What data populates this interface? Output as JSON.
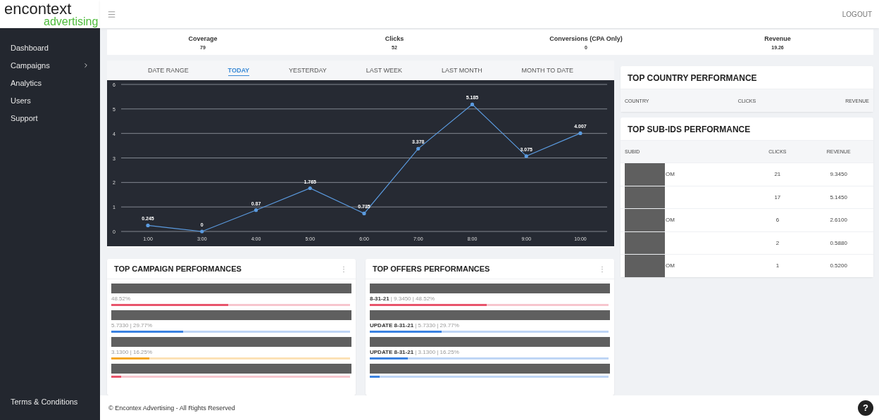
{
  "header": {
    "logo_main": "encontext",
    "logo_sub": "advertising",
    "logout": "LOGOUT"
  },
  "sidebar": {
    "items": [
      {
        "label": "Dashboard",
        "has_children": false
      },
      {
        "label": "Campaigns",
        "has_children": true
      },
      {
        "label": "Analytics",
        "has_children": false
      },
      {
        "label": "Users",
        "has_children": false
      },
      {
        "label": "Support",
        "has_children": false
      }
    ],
    "footer_link": "Terms & Conditions"
  },
  "stats": [
    {
      "label": "Coverage",
      "value": "79"
    },
    {
      "label": "Clicks",
      "value": "52"
    },
    {
      "label": "Conversions (CPA Only)",
      "value": "0"
    },
    {
      "label": "Revenue",
      "value": "19.26"
    }
  ],
  "range_tabs": [
    {
      "label": "DATE RANGE",
      "selected": false
    },
    {
      "label": "TODAY",
      "selected": true
    },
    {
      "label": "YESTERDAY",
      "selected": false
    },
    {
      "label": "LAST WEEK",
      "selected": false
    },
    {
      "label": "LAST MONTH",
      "selected": false
    },
    {
      "label": "MONTH TO DATE",
      "selected": false
    }
  ],
  "chart": {
    "chart_data": {
      "type": "line",
      "categories": [
        "1:00",
        "3:00",
        "4:00",
        "5:00",
        "6:00",
        "7:00",
        "8:00",
        "9:00",
        "10:00"
      ],
      "series": [
        {
          "color": "#5b9be0",
          "values": [
            0.245,
            0,
            0.87,
            1.765,
            0.735,
            3.378,
            5.185,
            3.075,
            4.007
          ]
        }
      ],
      "ylim": [
        0,
        6
      ],
      "grid": true,
      "yticks": [
        0,
        1,
        2,
        3,
        4,
        5,
        6
      ],
      "data_labels": true
    }
  },
  "top_campaigns": {
    "title": "TOP CAMPAIGN PERFORMANCES",
    "menu": "⋮",
    "items": [
      {
        "stats": "48.52%",
        "level": 0.49,
        "color": "#e8546b"
      },
      {
        "stats": "5.7330 | 29.77%",
        "level": 0.3,
        "color": "#3b82e0"
      },
      {
        "stats": "3.1300 | 16.25%",
        "level": 0.16,
        "color": "#f5a623"
      },
      {
        "level": 0.04,
        "color": "#e8546b"
      }
    ]
  },
  "top_offers": {
    "title": "TOP OFFERS PERFORMANCES",
    "menu": "⋮",
    "items": [
      {
        "stats": "**8-31-21** | 9.3450 | 48.52%",
        "level": 0.49,
        "color": "#e8546b"
      },
      {
        "stats": "**UPDATE 8-31-21** | 5.7330 | 29.77%",
        "level": 0.3,
        "color": "#3b82e0"
      },
      {
        "stats": "**UPDATE 8-31-21** | 3.1300 | 16.25%",
        "level": 0.16,
        "color": "#3b82e0"
      },
      {
        "level": 0.04,
        "color": "#3b82e0"
      }
    ]
  },
  "top_country": {
    "title": "TOP COUNTRY PERFORMANCE",
    "columns": [
      "COUNTRY",
      "CLICKS",
      "REVENUE"
    ]
  },
  "top_subids": {
    "title": "TOP SUB-IDS PERFORMANCE",
    "columns": [
      "SUBID",
      "CLICKS",
      "REVENUE"
    ],
    "rows": [
      {
        "subid": "OM",
        "clicks": "21",
        "revenue": "9.3450"
      },
      {
        "clicks": "17",
        "revenue": "5.1450"
      },
      {
        "subid": "OM",
        "clicks": "6",
        "revenue": "2.6100"
      },
      {
        "clicks": "2",
        "revenue": "0.5880"
      },
      {
        "subid": "OM",
        "clicks": "1",
        "revenue": "0.5200"
      }
    ]
  },
  "footer": {
    "copyright": "© Encontex Advertising - All Rights Reserved",
    "help": "?"
  }
}
